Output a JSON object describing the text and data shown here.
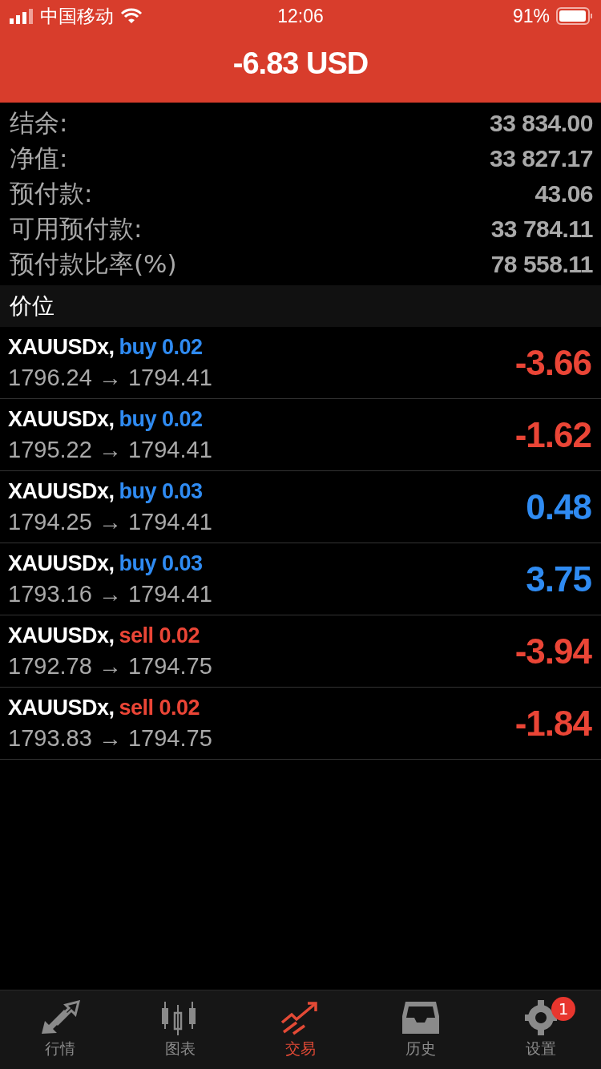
{
  "status_bar": {
    "carrier": "中国移动",
    "time": "12:06",
    "battery": "91%"
  },
  "header": {
    "title": "-6.83 USD"
  },
  "summary": [
    {
      "label": "结余:",
      "value": "33 834.00"
    },
    {
      "label": "净值:",
      "value": "33 827.17"
    },
    {
      "label": "预付款:",
      "value": "43.06"
    },
    {
      "label": "可用预付款:",
      "value": "33 784.11"
    },
    {
      "label": "预付款比率(%)",
      "value": "78 558.11"
    }
  ],
  "section_title": "价位",
  "positions": [
    {
      "symbol": "XAUUSDx,",
      "kind": "buy",
      "order": "buy 0.02",
      "prices": "1796.24 → 1794.41",
      "profit": "-3.66",
      "color": "#ea4536"
    },
    {
      "symbol": "XAUUSDx,",
      "kind": "buy",
      "order": "buy 0.02",
      "prices": "1795.22 → 1794.41",
      "profit": "-1.62",
      "color": "#ea4536"
    },
    {
      "symbol": "XAUUSDx,",
      "kind": "buy",
      "order": "buy 0.03",
      "prices": "1794.25 → 1794.41",
      "profit": "0.48",
      "color": "#2f8bf2"
    },
    {
      "symbol": "XAUUSDx,",
      "kind": "buy",
      "order": "buy 0.03",
      "prices": "1793.16 → 1794.41",
      "profit": "3.75",
      "color": "#2f8bf2"
    },
    {
      "symbol": "XAUUSDx,",
      "kind": "sell",
      "order": "sell 0.02",
      "prices": "1792.78 → 1794.75",
      "profit": "-3.94",
      "color": "#ea4536"
    },
    {
      "symbol": "XAUUSDx,",
      "kind": "sell",
      "order": "sell 0.02",
      "prices": "1793.83 → 1794.75",
      "profit": "-1.84",
      "color": "#ea4536"
    }
  ],
  "tabs": [
    {
      "label": "行情",
      "kind": "quotes",
      "selected": false
    },
    {
      "label": "图表",
      "kind": "chart",
      "selected": false
    },
    {
      "label": "交易",
      "kind": "trade",
      "selected": true
    },
    {
      "label": "历史",
      "kind": "history",
      "selected": false
    },
    {
      "label": "设置",
      "kind": "settings",
      "selected": false,
      "badge": "1"
    }
  ]
}
